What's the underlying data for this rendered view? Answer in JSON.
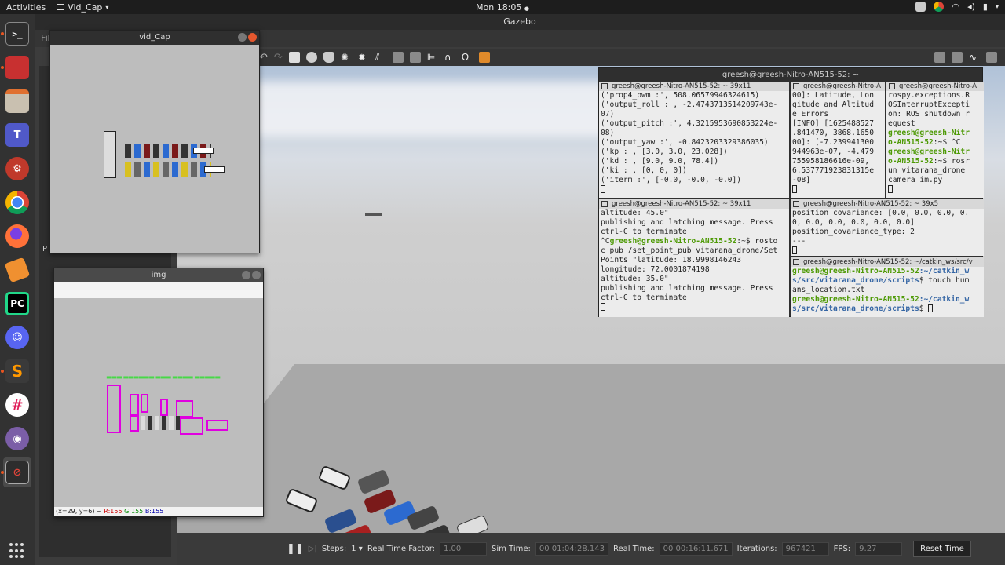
{
  "topbar": {
    "activities": "Activities",
    "app_name": "Vid_Cap",
    "clock": "Mon 18:05"
  },
  "dock": {
    "items": [
      "terminal-icon",
      "rviz-icon",
      "files-icon",
      "teams-icon",
      "settings-icon",
      "chrome-icon",
      "firefox-icon",
      "sublime-merge-icon",
      "pycharm-icon",
      "discord-icon",
      "sublime-text-icon",
      "slack-icon",
      "github-icon",
      "screen-recorder-icon"
    ]
  },
  "gazebo": {
    "title": "Gazebo",
    "menu": "Fil",
    "left_label": "P",
    "bottom": {
      "steps_label": "Steps:",
      "steps_value": "1",
      "rtf_label": "Real Time Factor:",
      "rtf_value": "1.00",
      "sim_time_label": "Sim Time:",
      "sim_time_value": "00 01:04:28.143",
      "real_time_label": "Real Time:",
      "real_time_value": "00 00:16:11.671",
      "iterations_label": "Iterations:",
      "iterations_value": "967421",
      "fps_label": "FPS:",
      "fps_value": "9.27",
      "reset_label": "Reset Time"
    }
  },
  "vidcap": {
    "title": "vid_Cap"
  },
  "img": {
    "title": "img",
    "status_pos": "(x=29, y=6) ~",
    "status_r": "R:155",
    "status_g": "G:155",
    "status_b": "B:155"
  },
  "terminal": {
    "title": "greesh@greesh-Nitro-AN515-52: ~",
    "panes": {
      "p1": {
        "header": "greesh@greesh-Nitro-AN515-52: ~ 39x11",
        "lines": [
          "('prop4_pwm :', 508.06579946324615)",
          "('output_roll :', -2.4743713514209743e-",
          "07)",
          "('output_pitch :', 4.3215953690853224e-",
          "08)",
          "('output_yaw :', -0.8423203329386035)",
          "('kp :', [3.0, 3.0, 23.028])",
          "('kd :', [9.0, 9.0, 78.4])",
          "('ki :', [0, 0, 0])",
          "('iterm :', [-0.0, -0.0, -0.0])"
        ]
      },
      "p2": {
        "header": "greesh@greesh-Nitro-A",
        "lines": [
          "00]: Latitude, Lon",
          "gitude and Altitud",
          "e Errors",
          "[INFO] [1625488527",
          ".841470, 3868.1650",
          "00]: [-7.239941300",
          "944963e-07, -4.479",
          "755958186616e-09,",
          "6.537771923831315e",
          "-08]"
        ]
      },
      "p3": {
        "header": "greesh@greesh-Nitro-A",
        "lines": [
          "rospy.exceptions.R",
          "OSInterruptExcepti",
          "on: ROS shutdown r",
          "equest"
        ],
        "prompt1": "greesh@greesh-Nitr",
        "prompt1b": "o-AN515-52",
        "cmd1": ":~$ ^C",
        "prompt2": "greesh@greesh-Nitr",
        "prompt2b": "o-AN515-52",
        "cmd2": ":~$ rosr",
        "cont": [
          "un vitarana_drone",
          "camera_im.py"
        ]
      },
      "p4": {
        "header": "greesh@greesh-Nitro-AN515-52: ~ 39x11",
        "lines_a": [
          "altitude: 45.0\"",
          "publishing and latching message. Press",
          "ctrl-C to terminate"
        ],
        "prompt_pre": "^C",
        "prompt": "greesh@greesh-Nitro-AN515-52",
        "cmd": ":~$ rosto",
        "lines_b": [
          "c pub /set_point_pub vitarana_drone/Set",
          "Points \"latitude: 18.9998146243",
          "longitude: 72.0001874198",
          "altitude: 35.0\"",
          "publishing and latching message. Press",
          "ctrl-C to terminate"
        ]
      },
      "p5": {
        "header": "greesh@greesh-Nitro-AN515-52: ~ 39x5",
        "lines": [
          "position_covariance: [0.0, 0.0, 0.0, 0.",
          "0, 0.0, 0.0, 0.0, 0.0, 0.0]",
          "position_covariance_type: 2",
          "---"
        ]
      },
      "p6": {
        "header": "greesh@greesh-Nitro-AN515-52: ~/catkin_ws/src/v",
        "p1": "greesh@greesh-Nitro-AN515-52",
        "path1": ":~/catkin_w",
        "path1b": "s/src/vitarana_drone/scripts",
        "cmd1": "$ touch hum",
        "cont1": "ans_location.txt",
        "p2": "greesh@greesh-Nitro-AN515-52",
        "path2": ":~/catkin_w",
        "path2b": "s/src/vitarana_drone/scripts",
        "cmd2": "$ "
      }
    }
  },
  "colors": {
    "accent": "#e95420",
    "prompt_green": "#4e9a06",
    "path_blue": "#3465a4",
    "detection_box": "#e000e0",
    "detection_label": "#33dd33"
  }
}
